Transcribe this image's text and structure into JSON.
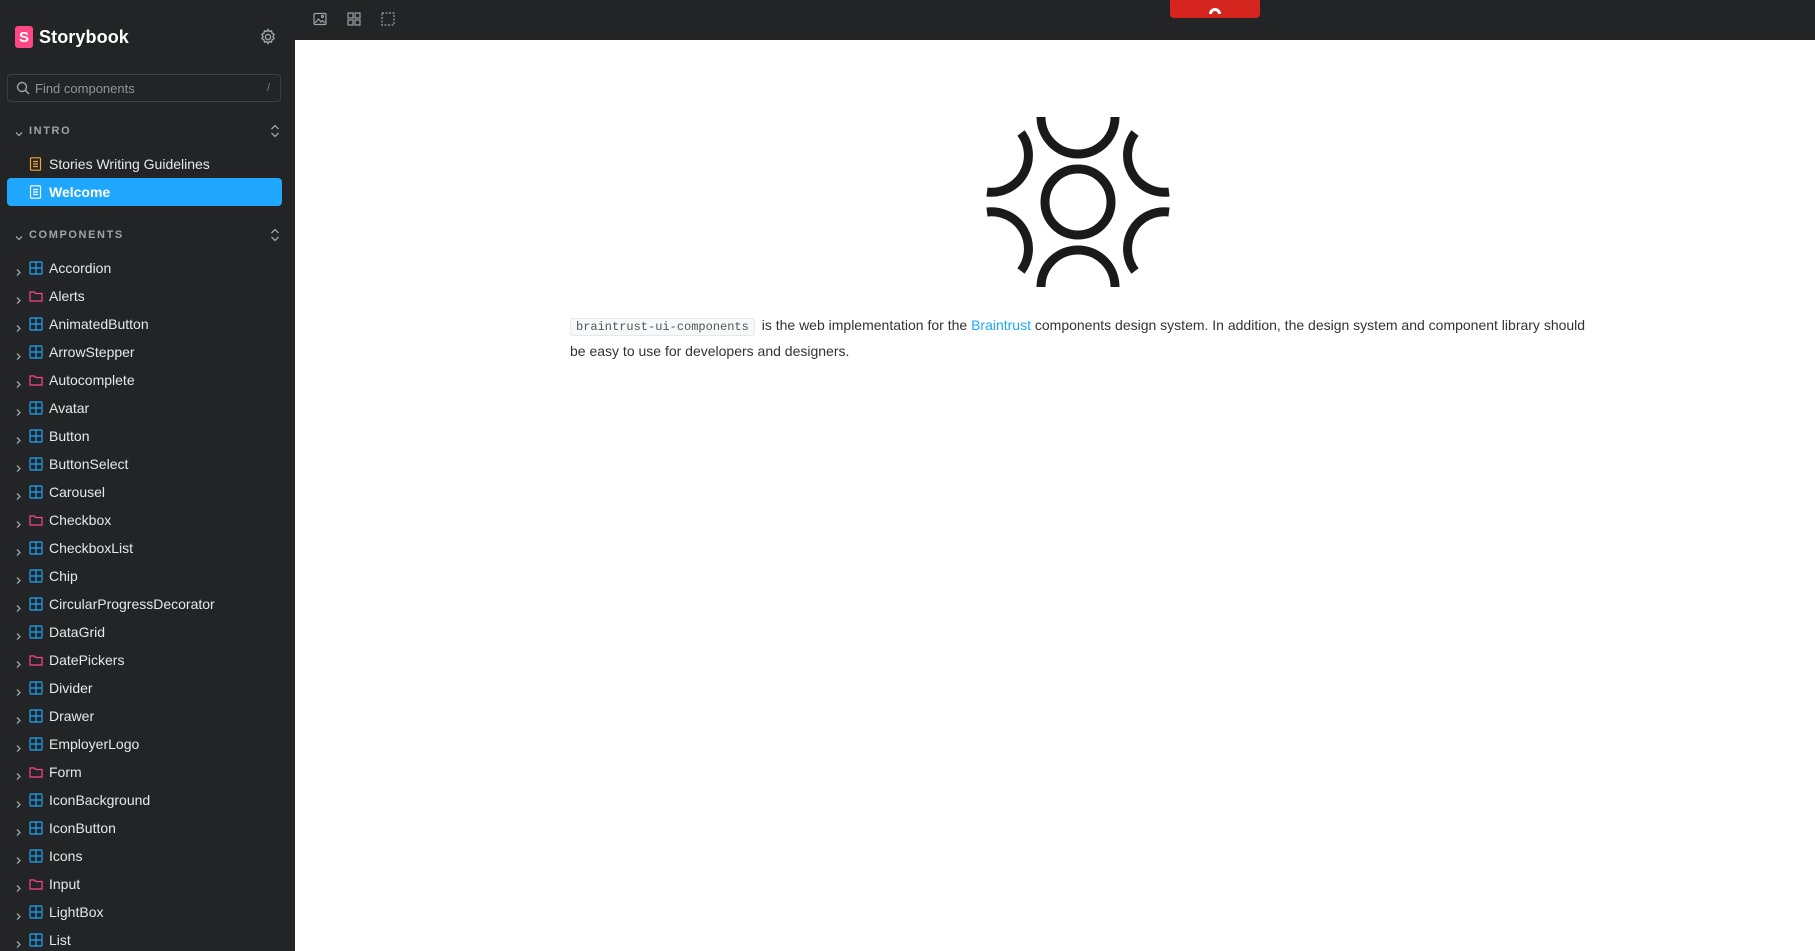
{
  "sidebar": {
    "brand_name": "Storybook",
    "brand_letter": "S",
    "search": {
      "placeholder": "Find components",
      "shortcut": "/"
    },
    "intro": {
      "title": "INTRO",
      "items": [
        {
          "label": "Stories Writing Guidelines",
          "selected": false
        },
        {
          "label": "Welcome",
          "selected": true
        }
      ]
    },
    "components": {
      "title": "COMPONENTS",
      "items": [
        {
          "label": "Accordion",
          "icon": "component-icon"
        },
        {
          "label": "Alerts",
          "icon": "folder-icon"
        },
        {
          "label": "AnimatedButton",
          "icon": "component-icon"
        },
        {
          "label": "ArrowStepper",
          "icon": "component-icon"
        },
        {
          "label": "Autocomplete",
          "icon": "folder-icon"
        },
        {
          "label": "Avatar",
          "icon": "component-icon"
        },
        {
          "label": "Button",
          "icon": "component-icon"
        },
        {
          "label": "ButtonSelect",
          "icon": "component-icon"
        },
        {
          "label": "Carousel",
          "icon": "component-icon"
        },
        {
          "label": "Checkbox",
          "icon": "folder-icon"
        },
        {
          "label": "CheckboxList",
          "icon": "component-icon"
        },
        {
          "label": "Chip",
          "icon": "component-icon"
        },
        {
          "label": "CircularProgressDecorator",
          "icon": "component-icon"
        },
        {
          "label": "DataGrid",
          "icon": "component-icon"
        },
        {
          "label": "DatePickers",
          "icon": "folder-icon"
        },
        {
          "label": "Divider",
          "icon": "component-icon"
        },
        {
          "label": "Drawer",
          "icon": "component-icon"
        },
        {
          "label": "EmployerLogo",
          "icon": "component-icon"
        },
        {
          "label": "Form",
          "icon": "folder-icon"
        },
        {
          "label": "IconBackground",
          "icon": "component-icon"
        },
        {
          "label": "IconButton",
          "icon": "component-icon"
        },
        {
          "label": "Icons",
          "icon": "component-icon"
        },
        {
          "label": "Input",
          "icon": "folder-icon"
        },
        {
          "label": "LightBox",
          "icon": "component-icon"
        },
        {
          "label": "List",
          "icon": "component-icon"
        }
      ]
    }
  },
  "toolbar": {
    "tools": [
      "image-icon",
      "grid-icon",
      "outline-icon"
    ]
  },
  "preview": {
    "package_name": "braintrust-ui-components",
    "text_before_link": " is the web implementation for the ",
    "link_text": "Braintrust",
    "text_after_link": " components design system. In addition, the design system and component library should be easy to use for developers and designers."
  },
  "colors": {
    "sidebar_bg": "#222425",
    "accent": "#1ea7fd",
    "brand_pink": "#ff4785",
    "folder_pink": "#ff4785",
    "doc_orange": "#f3a63a",
    "badge_red": "#d6251f"
  }
}
